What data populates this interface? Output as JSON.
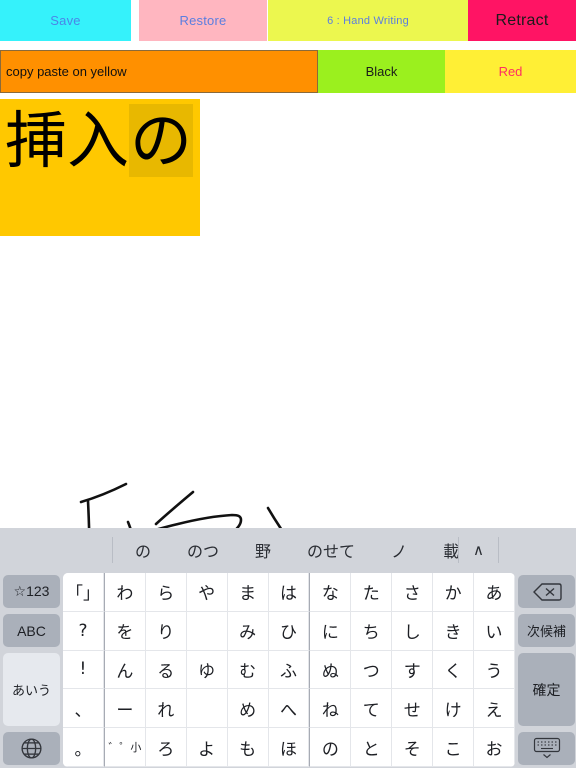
{
  "toolbar": {
    "save_label": "Save",
    "restore_label": "Restore",
    "mode_label": "6 : Hand Writing",
    "retract_label": "Retract"
  },
  "options_row": {
    "copy_field_value": "copy paste on yellow",
    "copy_field_placeholder": "copy paste on yellow",
    "black_label": "Black",
    "red_label": "Red"
  },
  "text_area": {
    "text_plain": "挿入",
    "text_marked": "の",
    "background_color": "#ffc800",
    "marker_color": "#e8b800"
  },
  "canvas": {
    "stroke_color": "#111111",
    "background_color": "#ffffff",
    "recognized_text": "挿入"
  },
  "keyboard": {
    "candidates": [
      "の",
      "のつ",
      "野",
      "のせて",
      "ノ",
      "載せ"
    ],
    "expand_icon": "∧",
    "rows": [
      {
        "left": {
          "label": "☆123",
          "name": "key-symbols",
          "style": "dark"
        },
        "keys": [
          "「」",
          "わ",
          "ら",
          "や",
          "ま",
          "は",
          "な",
          "た",
          "さ",
          "か",
          "あ"
        ],
        "right": {
          "label": "",
          "name": "key-backspace",
          "icon": "backspace-icon",
          "style": "dark"
        }
      },
      {
        "left": {
          "label": "ABC",
          "name": "key-abc",
          "style": "dark"
        },
        "keys": [
          "?",
          "を",
          "り",
          "",
          "み",
          "ひ",
          "に",
          "ち",
          "し",
          "き",
          "い"
        ],
        "right": {
          "label": "次候補",
          "name": "key-next-candidate",
          "style": "dark"
        }
      },
      {
        "left": {
          "label": "あいう",
          "name": "key-kana-mode",
          "style": "light"
        },
        "keys": [
          "!",
          "ん",
          "る",
          "ゆ",
          "む",
          "ふ",
          "ぬ",
          "つ",
          "す",
          "く",
          "う"
        ],
        "right": {
          "label": "確定",
          "name": "key-confirm",
          "style": "dark"
        }
      },
      {
        "left": {
          "label": "",
          "name": "key-kana-mode-spacer",
          "style": "light"
        },
        "keys": [
          "、",
          "ー",
          "れ",
          "",
          "め",
          "へ",
          "ね",
          "て",
          "せ",
          "け",
          "え"
        ],
        "right": {
          "label": "",
          "name": "key-confirm-spacer",
          "style": "dark"
        }
      },
      {
        "left": {
          "label": "",
          "name": "key-globe",
          "icon": "globe-icon",
          "style": "dark"
        },
        "keys": [
          "。",
          "゛゜小",
          "ろ",
          "よ",
          "も",
          "ほ",
          "の",
          "と",
          "そ",
          "こ",
          "お"
        ],
        "right": {
          "label": "",
          "name": "key-hide-keyboard",
          "icon": "hide-keyboard-icon",
          "style": "dark"
        }
      }
    ]
  }
}
